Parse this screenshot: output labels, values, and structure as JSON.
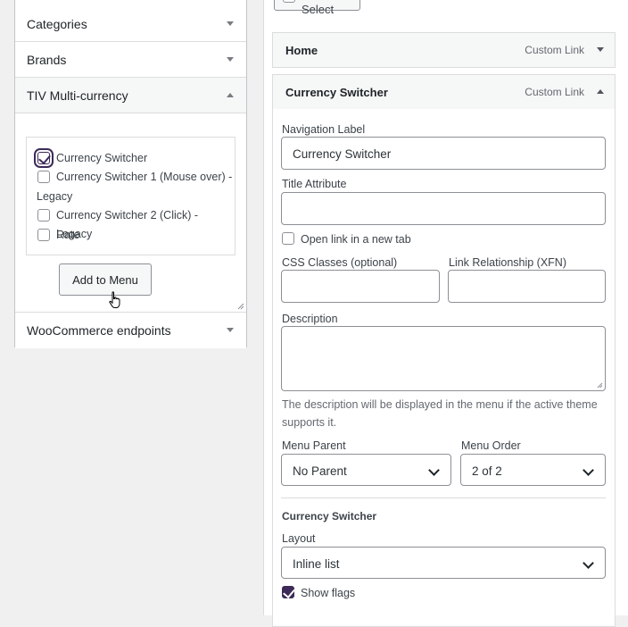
{
  "left_panel": {
    "sections": [
      {
        "label": "Categories",
        "state": "collapsed"
      },
      {
        "label": "Brands",
        "state": "collapsed"
      },
      {
        "label": "TIV Multi-currency",
        "state": "expanded"
      },
      {
        "label": "WooCommerce endpoints",
        "state": "collapsed"
      }
    ],
    "currency_items": [
      {
        "label": "Currency Switcher",
        "checked": true
      },
      {
        "label": "Currency Switcher 1 (Mouse over) -",
        "label_cont": "Legacy",
        "checked": false
      },
      {
        "label": "Currency Switcher 2 (Click) - Legacy",
        "checked": false
      },
      {
        "label": "Rate",
        "checked": false
      }
    ],
    "add_button": "Add to Menu"
  },
  "right_panel": {
    "bulk_select": "Bulk Select",
    "items": [
      {
        "title": "Home",
        "type": "Custom Link"
      },
      {
        "title": "Currency Switcher",
        "type": "Custom Link"
      }
    ],
    "form": {
      "nav_label": "Navigation Label",
      "nav_value": "Currency Switcher",
      "title_attr": "Title Attribute",
      "title_value": "",
      "new_tab": "Open link in a new tab",
      "css_classes": "CSS Classes (optional)",
      "xfn": "Link Relationship (XFN)",
      "description": "Description",
      "desc_note_1": "The description will be displayed in the menu if the active theme",
      "desc_note_2": "supports it.",
      "menu_parent": "Menu Parent",
      "menu_parent_value": "No Parent",
      "menu_order": "Menu Order",
      "menu_order_value": "2 of 2",
      "section_title": "Currency Switcher",
      "layout": "Layout",
      "layout_value": "Inline list",
      "show_flags": "Show flags",
      "show_flags_checked": true
    }
  },
  "colors": {
    "accent": "#3c2a57",
    "border": "#8c8f94",
    "panel_bg": "#f6f7f7"
  }
}
